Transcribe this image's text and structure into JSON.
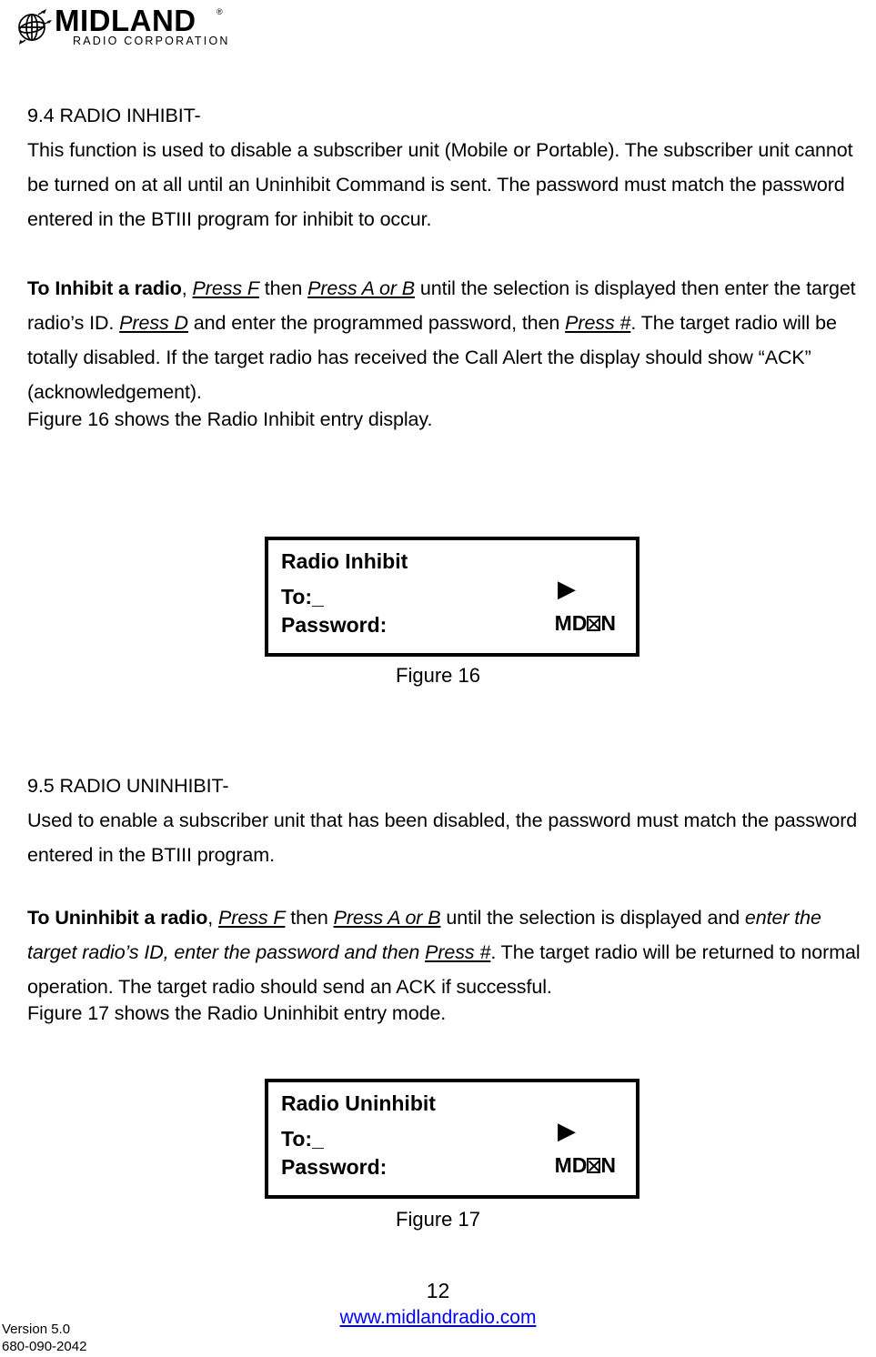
{
  "header": {
    "logo_brand": "MIDLAND",
    "logo_tagline": "RADIO CORPORATION",
    "logo_trademark": "®",
    "globe_icon": "globe-icon"
  },
  "sections": [
    {
      "id": "radio-inhibit",
      "heading": "9.4 RADIO INHIBIT-",
      "intro": "This function is used to disable a subscriber unit (Mobile or Portable). The subscriber unit cannot be turned on at all until an Uninhibit Command is sent. The password must match the password entered in the BTIII program for inhibit to occur.",
      "instruction": {
        "lead_bold": "To Inhibit a radio",
        "t1": ", ",
        "press_f": "Press F",
        "t2": " then ",
        "press_ab": "Press A or B",
        "t3": " until the selection is displayed then enter the target radio’s ID.  ",
        "press_d": "Press D",
        "t4": " and enter the programmed password, then ",
        "press_hash": "Press #",
        "t5": ". The target radio will be totally disabled. If the target radio has received the Call Alert the display should show “ACK” (acknowledgement)."
      },
      "figure_ref": "Figure 16 shows the Radio Inhibit entry display."
    },
    {
      "id": "radio-uninhibit",
      "heading": "9.5 RADIO UNINHIBIT-",
      "intro": "Used to enable a subscriber unit that has been disabled, the password must match the password entered in the BTIII program.",
      "instruction": {
        "lead_bold": "To Uninhibit a radio",
        "t1": ", ",
        "press_f": "Press F",
        "t2": " then ",
        "press_ab": "Press A or B",
        "t3": " until the selection is displayed and ",
        "italic_run": "enter the target radio’s ID, enter the password and then ",
        "press_hash": "Press #",
        "t4": ". The target radio will be returned to normal operation. The target radio should send an ACK if successful."
      },
      "figure_ref": "Figure 17 shows the Radio Uninhibit entry mode."
    }
  ],
  "figures": [
    {
      "id": "figure-16",
      "title": "Radio Inhibit",
      "to_label": "To:",
      "to_value": "_",
      "arrow_icon": "▶",
      "password_label": "Password:",
      "code_prefix": "MD",
      "code_suffix": "N",
      "caption": "Figure 16"
    },
    {
      "id": "figure-17",
      "title": "Radio Uninhibit",
      "to_label": "To:",
      "to_value": "_",
      "arrow_icon": "▶",
      "password_label": "Password:",
      "code_prefix": "MD",
      "code_suffix": "N",
      "caption": "Figure 17"
    }
  ],
  "footer": {
    "page_number": "12",
    "website": "www.midlandradio.com",
    "version": "Version 5.0",
    "part_number": "680-090-2042",
    "link_color": "#0000ff"
  }
}
